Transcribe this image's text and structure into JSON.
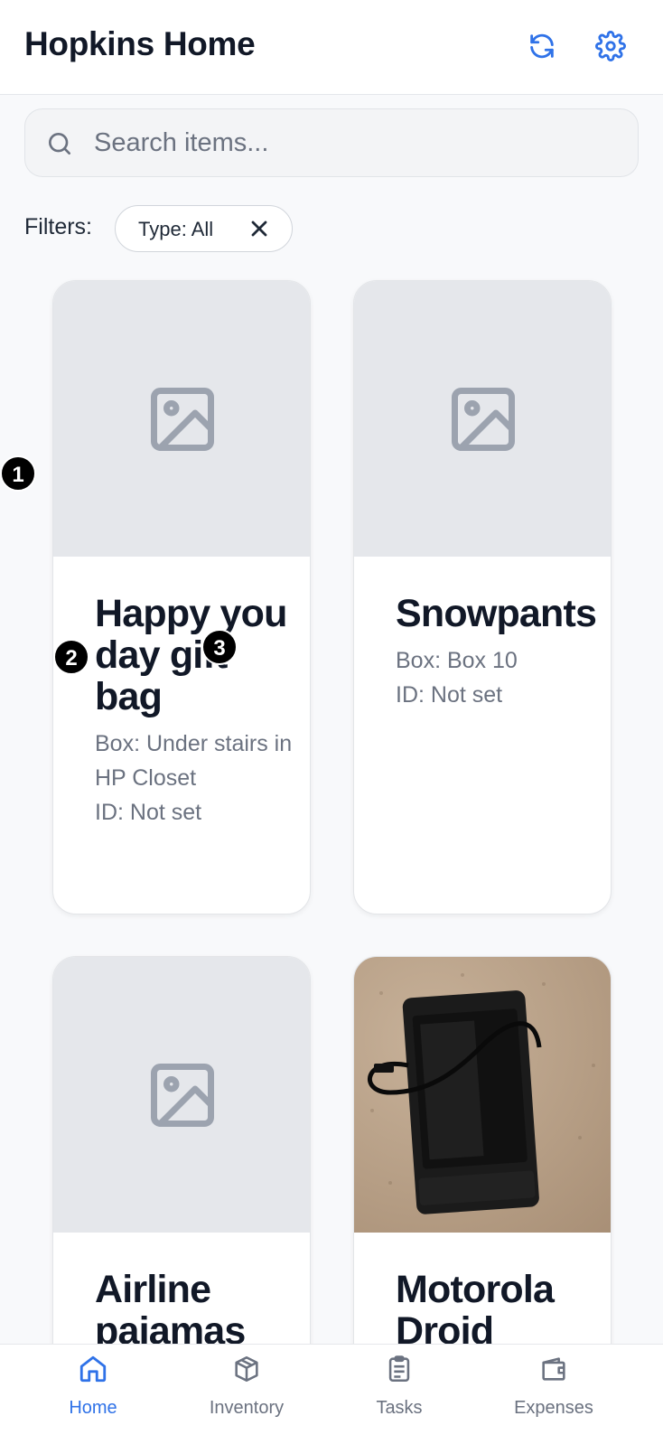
{
  "header": {
    "title": "Hopkins Home",
    "refresh_icon": "refresh-icon",
    "settings_icon": "gear-icon"
  },
  "search": {
    "placeholder": "Search items...",
    "value": ""
  },
  "filters": {
    "label": "Filters:",
    "chips": [
      {
        "label": "Type: All"
      }
    ]
  },
  "items": [
    {
      "name": "Happy you day gift bag",
      "box": "Box: Under stairs in HP Closet",
      "id": "ID: Not set",
      "image": "placeholder-image-icon"
    },
    {
      "name": "Snowpants",
      "box": "Box: Box 10",
      "id": "ID: Not set",
      "image": "placeholder-image-icon"
    },
    {
      "name": "Airline pajamas",
      "image": "placeholder-image-icon"
    },
    {
      "name": "Motorola Droid",
      "image": "phone-photo"
    }
  ],
  "markers": [
    "1",
    "2",
    "3"
  ],
  "nav": {
    "items": [
      {
        "label": "Home",
        "icon": "home-icon",
        "active": true
      },
      {
        "label": "Inventory",
        "icon": "box-icon",
        "active": false
      },
      {
        "label": "Tasks",
        "icon": "clipboard-icon",
        "active": false
      },
      {
        "label": "Expenses",
        "icon": "wallet-icon",
        "active": false
      }
    ]
  },
  "colors": {
    "accent": "#2f72e8",
    "text_primary": "#111827",
    "text_secondary": "#6b7280",
    "image_placeholder_bg": "#e5e7eb",
    "page_bg": "#f8f9fb"
  }
}
